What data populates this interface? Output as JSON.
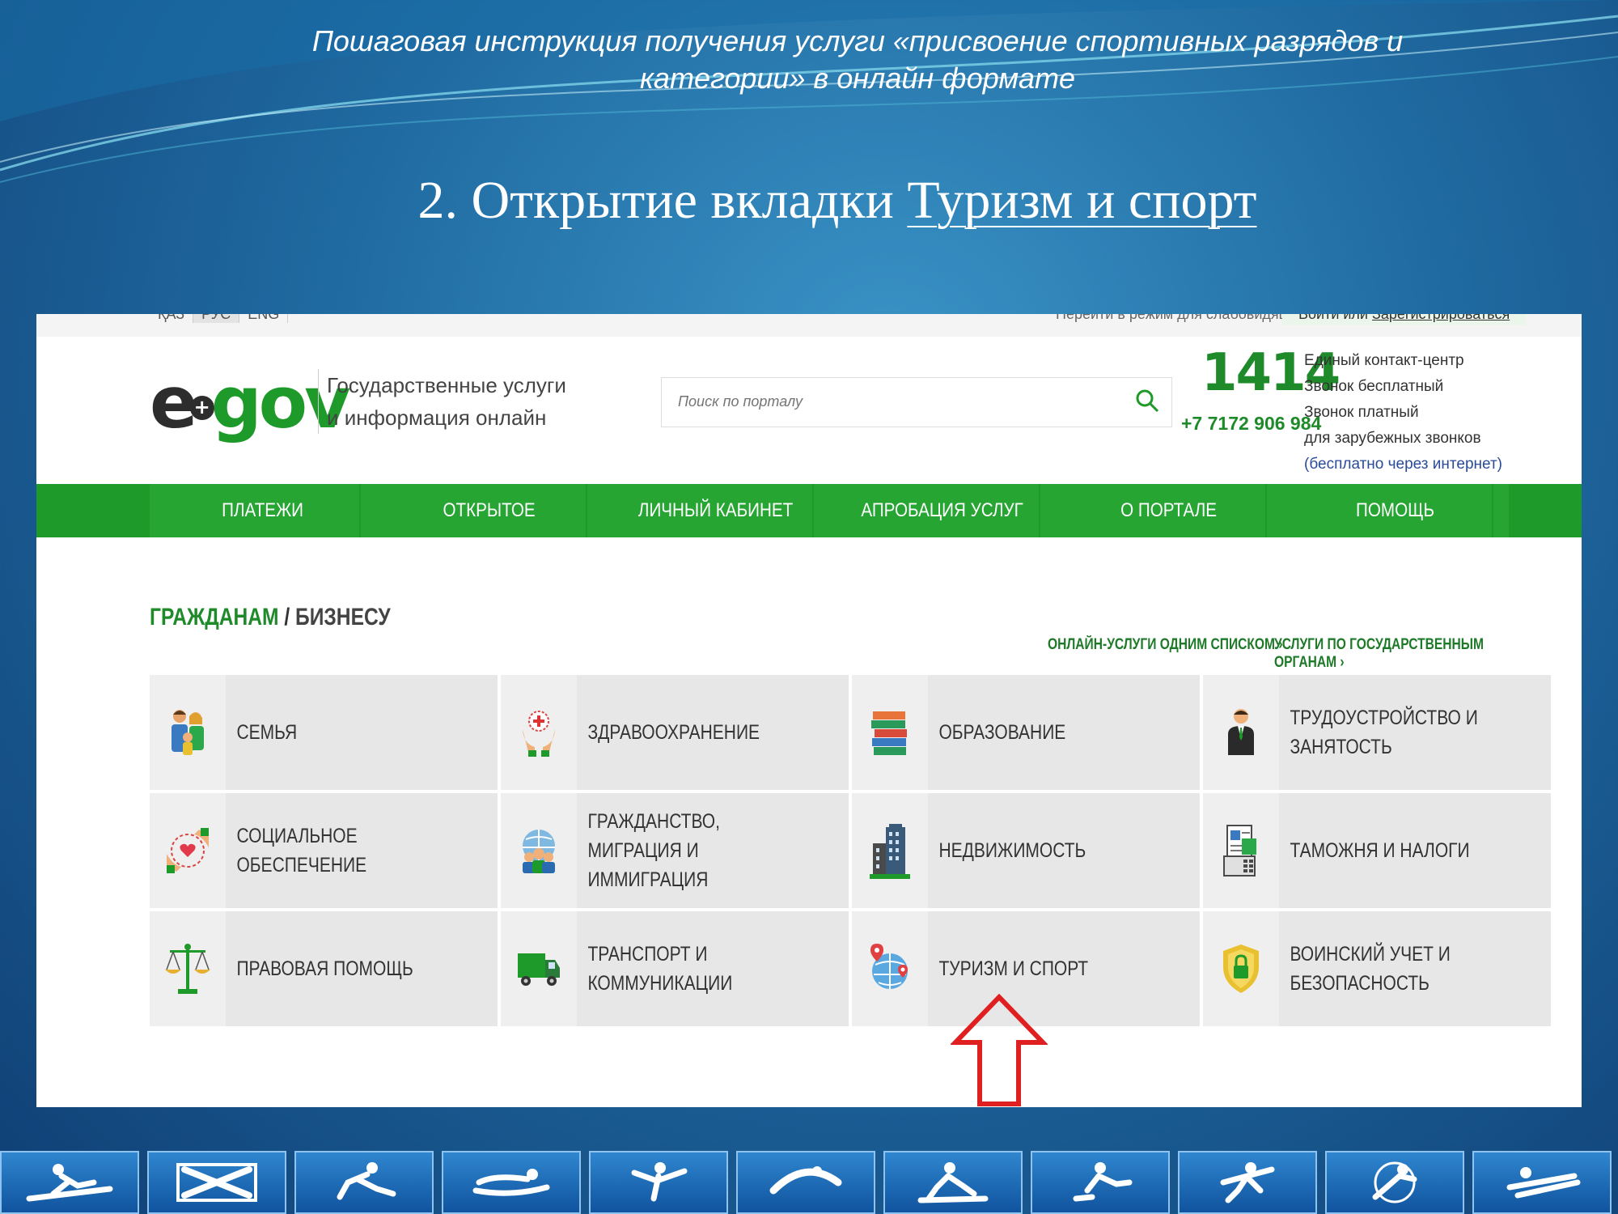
{
  "slide": {
    "title_line1": "Пошаговая инструкция получения услуги «присвоение спортивных разрядов и",
    "title_line2": "категории» в онлайн формате",
    "heading_prefix": "2. Открытие вкладки ",
    "heading_link": "Туризм и спорт"
  },
  "topbar": {
    "languages": [
      "ҚАЗ",
      "РУС",
      "ENG"
    ],
    "active_language": "РУС",
    "impaired_mode": "Перейти в режим для слабовидящих",
    "login": "Войти или",
    "register": "Зарегистрироваться"
  },
  "header": {
    "logo_e": "e",
    "logo_gov": "gov",
    "tagline_line1": "Государственные услуги",
    "tagline_line2": "и информация онлайн",
    "search_placeholder": "Поиск по порталу",
    "phone_short": "1414",
    "phone_long": "+7 7172 906 984",
    "contact_lines": [
      "Единый контакт-центр",
      "Звонок бесплатный",
      "Звонок платный",
      "для зарубежных звонков",
      "(бесплатно через интернет)"
    ]
  },
  "nav": {
    "items": [
      "ПЛАТЕЖИ",
      "ОТКРЫТОЕ ПРАВИТЕЛЬСТВО",
      "ЛИЧНЫЙ КАБИНЕТ",
      "АПРОБАЦИЯ УСЛУГ",
      "О ПОРТАЛЕ",
      "ПОМОЩЬ"
    ]
  },
  "section": {
    "citizens": "ГРАЖДАНАМ",
    "separator": " / ",
    "business": "БИЗНЕСУ",
    "link_list": "ОНЛАЙН-УСЛУГИ ОДНИМ СПИСКОМ ›",
    "link_agencies": "УСЛУГИ ПО ГОСУДАРСТВЕННЫМ ОРГАНАМ ›"
  },
  "categories": [
    {
      "label": "СЕМЬЯ",
      "icon": "family-icon"
    },
    {
      "label": "ЗДРАВООХРАНЕНИЕ",
      "icon": "healthcare-icon"
    },
    {
      "label": "ОБРАЗОВАНИЕ",
      "icon": "books-icon"
    },
    {
      "label": "ТРУДОУСТРОЙСТВО И ЗАНЯТОСТЬ",
      "icon": "employee-icon"
    },
    {
      "label": "СОЦИАЛЬНОЕ ОБЕСПЕЧЕНИЕ",
      "icon": "social-care-icon"
    },
    {
      "label": "ГРАЖДАНСТВО, МИГРАЦИЯ И ИММИГРАЦИЯ",
      "icon": "globe-people-icon"
    },
    {
      "label": "НЕДВИЖИМОСТЬ",
      "icon": "buildings-icon"
    },
    {
      "label": "ТАМОЖНЯ И НАЛОГИ",
      "icon": "documents-icon"
    },
    {
      "label": "ПРАВОВАЯ ПОМОЩЬ",
      "icon": "scales-icon"
    },
    {
      "label": "ТРАНСПОРТ И КОММУНИКАЦИИ",
      "icon": "truck-icon"
    },
    {
      "label": "ТУРИЗМ И СПОРТ",
      "icon": "globe-pin-icon"
    },
    {
      "label": "ВОИНСКИЙ УЧЕТ И БЕЗОПАСНОСТЬ",
      "icon": "shield-lock-icon"
    }
  ],
  "colors": {
    "brand_green": "#1e9a2b",
    "arrow_red": "#e02020",
    "slide_blue": "#1f6aa1"
  }
}
